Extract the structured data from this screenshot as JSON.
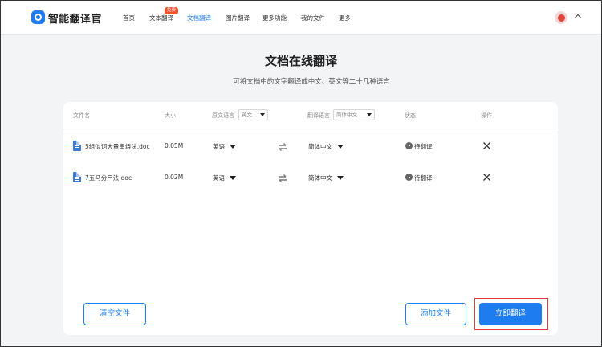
{
  "app": {
    "title": "智能翻译官",
    "logo_icon": "translate-logo-icon",
    "accent": "#1c7cf0"
  },
  "nav": {
    "items": [
      {
        "label": "首页",
        "active": false
      },
      {
        "label": "文本翻译",
        "active": false,
        "badge": "免费"
      },
      {
        "label": "文档翻译",
        "active": true
      },
      {
        "label": "图片翻译",
        "active": false
      },
      {
        "label": "更多功能",
        "active": false
      },
      {
        "label": "我的文件",
        "active": false
      },
      {
        "label": "更多",
        "active": false
      }
    ]
  },
  "page": {
    "title": "文档在线翻译",
    "subtitle": "可将文档中的文字翻译成中文、英文等二十几种语言"
  },
  "table": {
    "headers": {
      "filename": "文件名",
      "size": "大小",
      "source_lang": "原文语言",
      "source_lang_select": "英文",
      "target_lang": "翻译语言",
      "target_lang_select": "简体中文",
      "status": "状态",
      "action": "操作"
    },
    "rows": [
      {
        "filename": "5组似词大量串烧法.doc",
        "size": "0.05M",
        "source": "英语",
        "target": "简体中文",
        "status": "待翻译"
      },
      {
        "filename": "7五马分尸法.doc",
        "size": "0.02M",
        "source": "英语",
        "target": "简体中文",
        "status": "待翻译"
      }
    ]
  },
  "buttons": {
    "clear": "清空文件",
    "add": "添加文件",
    "translate": "立即翻译"
  }
}
